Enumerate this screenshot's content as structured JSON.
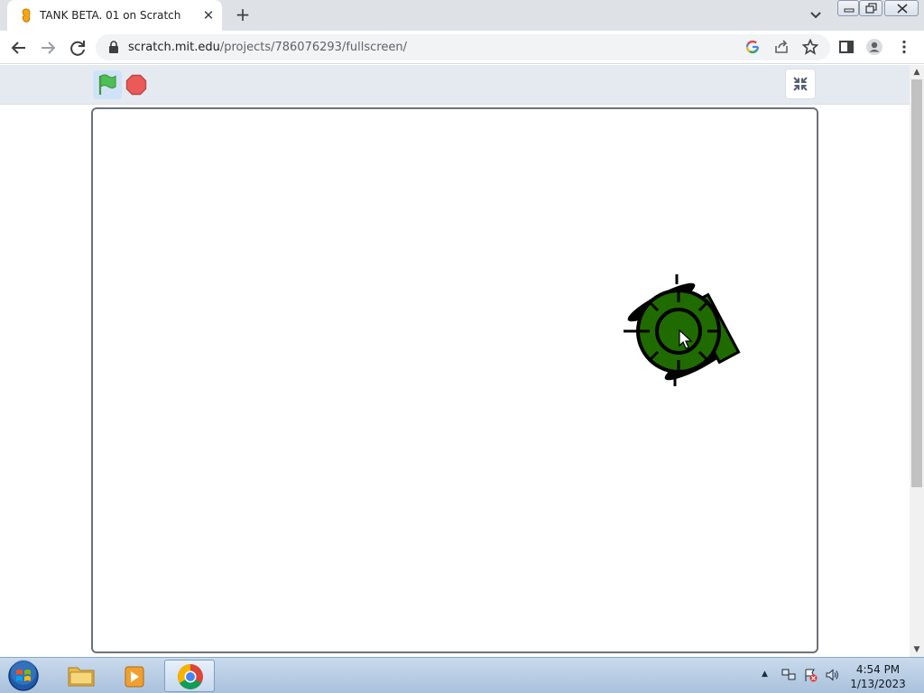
{
  "browser": {
    "tab": {
      "title": "TANK BETA. 01 on Scratch",
      "close_glyph": "✕",
      "favicon": "scratch-cat-icon"
    },
    "new_tab_glyph": "+",
    "url": {
      "host": "scratch.mit.edu",
      "path": "/projects/786076293/fullscreen/"
    },
    "toolbar_icons": [
      "back-icon",
      "forward-icon",
      "reload-icon",
      "lock-icon",
      "google-icon",
      "share-icon",
      "bookmark-star-icon",
      "side-panel-icon",
      "profile-icon",
      "menu-kebab-icon"
    ]
  },
  "player": {
    "icons": [
      "green-flag-icon",
      "stop-icon",
      "exit-fullscreen-icon"
    ],
    "colors": {
      "flag": "#4cbf56",
      "stop": "#ec5959",
      "tank_body": "#1f6b00"
    }
  },
  "scrollbar": {
    "up_glyph": "▲",
    "down_glyph": "▼"
  },
  "taskbar": {
    "tray_arrow": "▲",
    "time": "4:54 PM",
    "date": "1/13/2023",
    "items": [
      "windows-start-icon",
      "file-explorer-icon",
      "media-player-icon",
      "chrome-icon"
    ]
  }
}
